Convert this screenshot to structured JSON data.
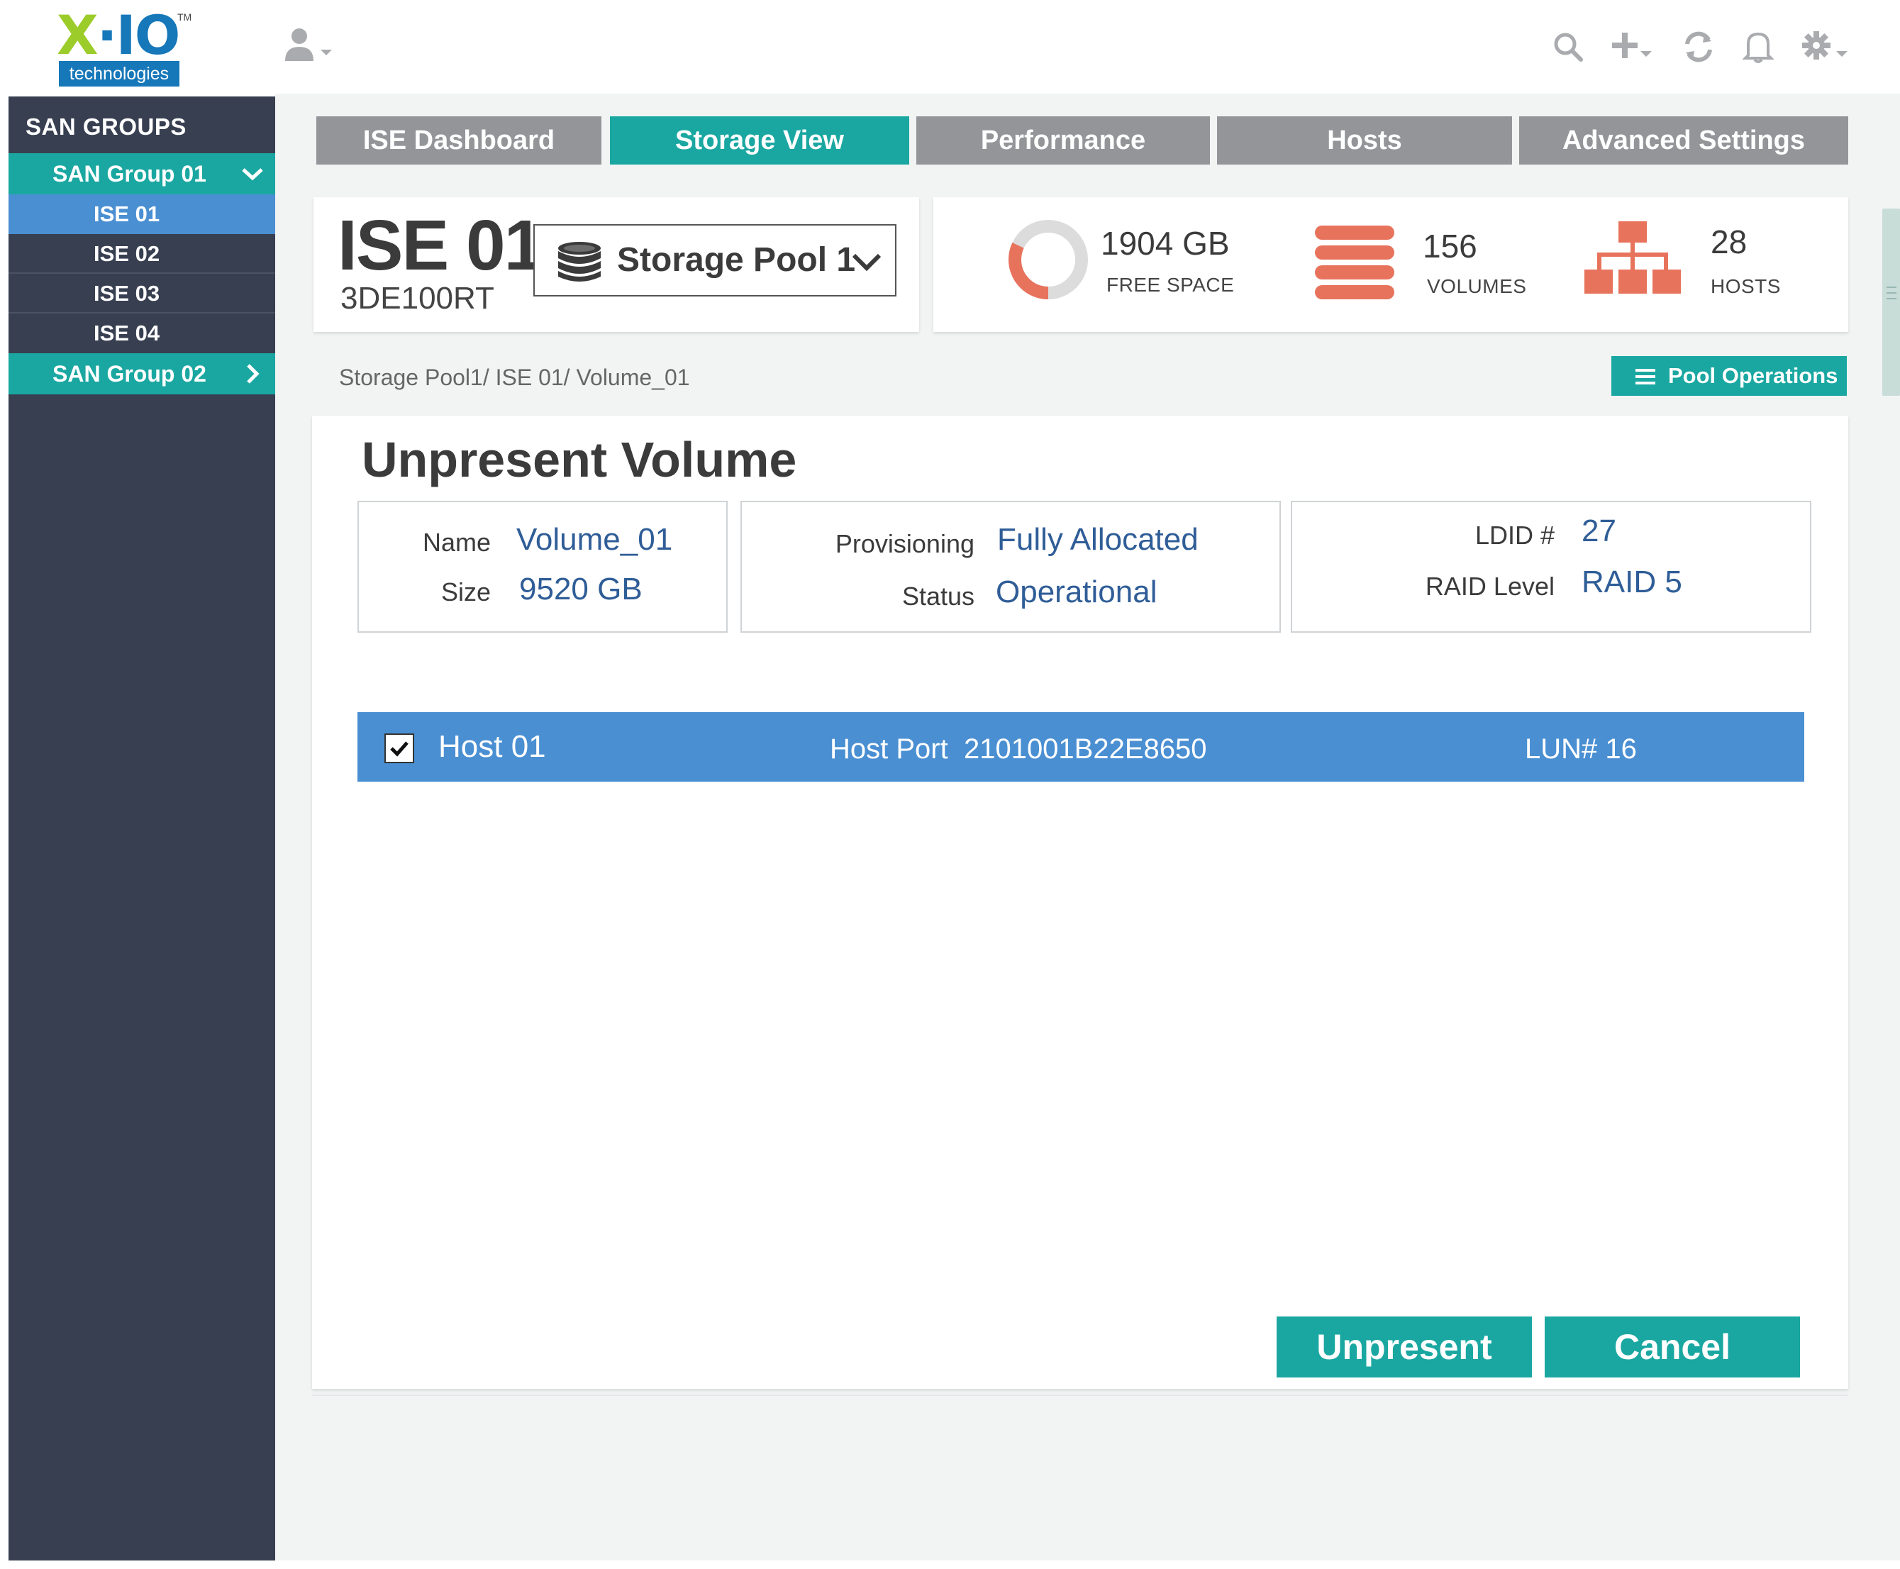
{
  "app": {
    "logo_text": "X·IO",
    "logo_tm": "TM",
    "logo_sub": "technologies"
  },
  "icons": {
    "user": "user-icon",
    "search": "search-icon",
    "add": "plus-icon",
    "refresh": "refresh-icon",
    "notifications": "bell-icon",
    "settings": "gear-icon"
  },
  "colors": {
    "teal_accent": "#1aa7a1",
    "selected_blue": "#4a8fd2",
    "sidebar_bg": "#373f51",
    "tab_inactive": "#939599",
    "stat_orange": "#e8735c",
    "value_blue": "#2f5d97"
  },
  "sidebar": {
    "title": "SAN GROUPS",
    "groups": [
      {
        "label": "SAN Group 01",
        "expanded": true,
        "items": [
          {
            "label": "ISE 01",
            "active": true
          },
          {
            "label": "ISE 02",
            "active": false
          },
          {
            "label": "ISE 03",
            "active": false
          },
          {
            "label": "ISE 04",
            "active": false
          }
        ]
      },
      {
        "label": "SAN Group 02",
        "expanded": false
      }
    ]
  },
  "tabs": [
    {
      "label": "ISE Dashboard",
      "active": false
    },
    {
      "label": "Storage View",
      "active": true
    },
    {
      "label": "Performance",
      "active": false
    },
    {
      "label": "Hosts",
      "active": false
    },
    {
      "label": "Advanced Settings",
      "active": false
    }
  ],
  "ise": {
    "name": "ISE 01",
    "serial": "3DE100RT",
    "pool_selected": "Storage Pool 1"
  },
  "stats": {
    "free_space": {
      "value": "1904 GB",
      "label": "FREE SPACE",
      "used_fraction": 0.32
    },
    "volumes": {
      "value": "156",
      "label": "VOLUMES"
    },
    "hosts": {
      "value": "28",
      "label": "HOSTS"
    }
  },
  "breadcrumb": "Storage Pool1/ ISE 01/ Volume_01",
  "pool_operations_label": "Pool Operations",
  "dialog": {
    "title": "Unpresent Volume",
    "fields": {
      "name_label": "Name",
      "name_value": "Volume_01",
      "size_label": "Size",
      "size_value": "9520 GB",
      "provisioning_label": "Provisioning",
      "provisioning_value": "Fully Allocated",
      "status_label": "Status",
      "status_value": "Operational",
      "ldid_label": "LDID #",
      "ldid_value": "27",
      "raid_label": "RAID Level",
      "raid_value": "RAID 5"
    },
    "hosts": [
      {
        "checked": true,
        "name": "Host 01",
        "port_label": "Host Port",
        "port_value": "2101001B22E8650",
        "lun": "LUN# 16"
      }
    ],
    "unpresent_label": "Unpresent",
    "cancel_label": "Cancel"
  }
}
